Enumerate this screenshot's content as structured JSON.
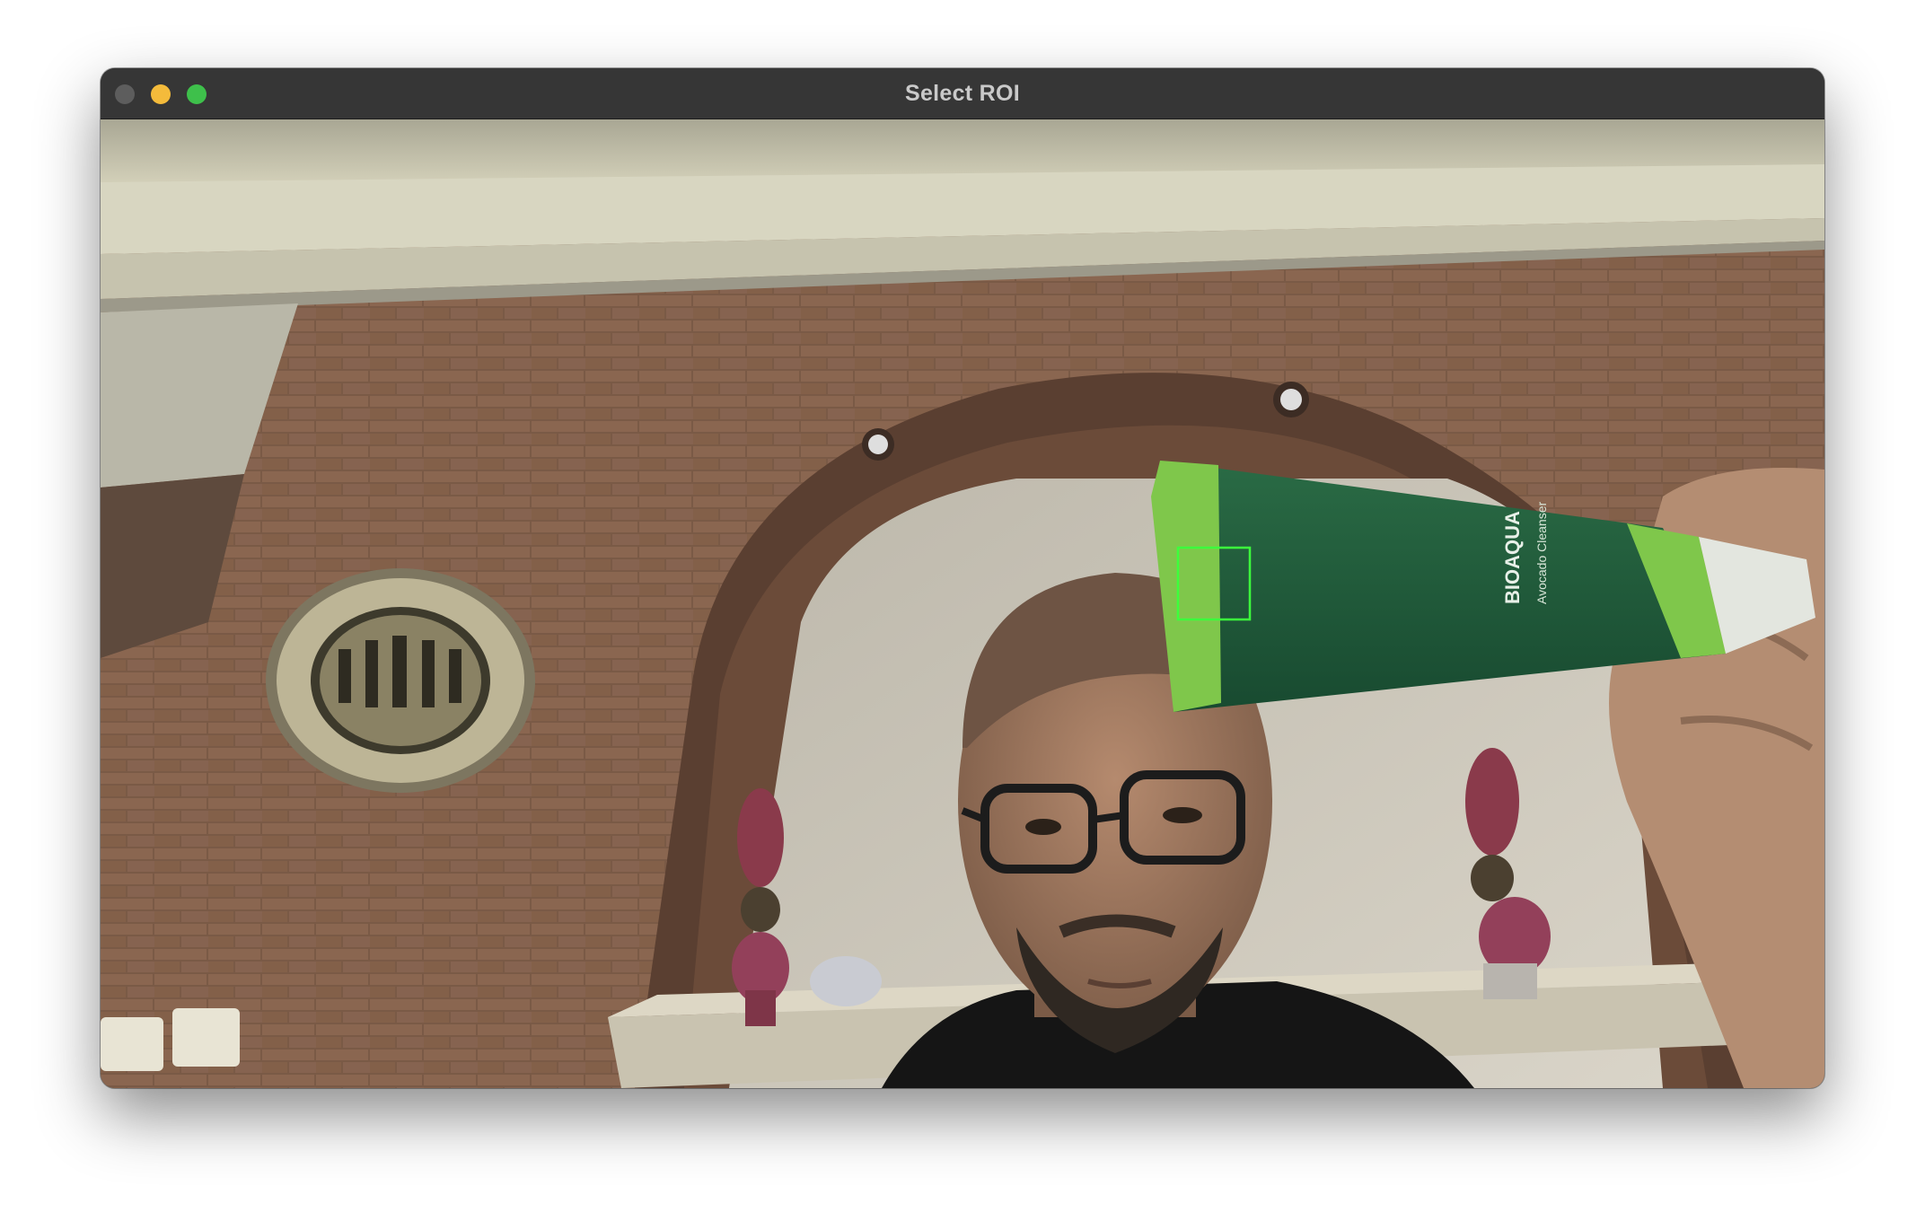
{
  "window": {
    "title": "Select ROI",
    "controls": [
      "close-button",
      "minimize-button",
      "maximize-button"
    ]
  },
  "camera_view": {
    "product_label": {
      "brand": "BIOAQUA",
      "line": "Avocado Cleanser"
    }
  },
  "colors": {
    "roi_box": "#3cff3c",
    "titlebar": "#363636",
    "tube": "#1f5b3a",
    "tube_cap": "#7fc74b"
  }
}
